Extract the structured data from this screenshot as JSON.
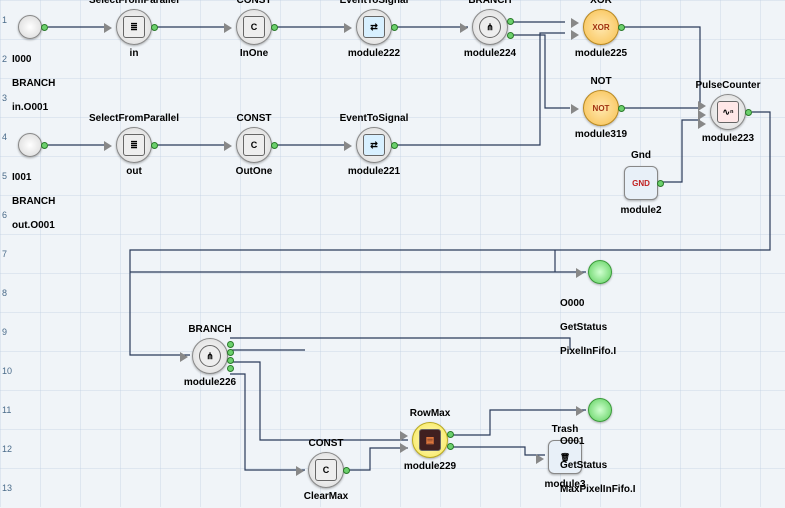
{
  "rowNumbers": [
    "1",
    "2",
    "3",
    "4",
    "5",
    "6",
    "7",
    "8",
    "9",
    "10",
    "11",
    "12",
    "13"
  ],
  "inputs": {
    "I000": {
      "id": "I000",
      "line1": "BRANCH",
      "line2": "in.O001"
    },
    "I001": {
      "id": "I001",
      "line1": "BRANCH",
      "line2": "out.O001"
    }
  },
  "outputs": {
    "O000": {
      "id": "O000",
      "line1": "GetStatus",
      "line2": "PixelInFifo.I"
    },
    "O001": {
      "id": "O001",
      "line1": "GetStatus",
      "line2": "MaxPixelInFifo.I"
    }
  },
  "modules": {
    "sfp_in": {
      "type": "SelectFromParallel",
      "name": "in"
    },
    "sfp_out": {
      "type": "SelectFromParallel",
      "name": "out"
    },
    "const_in": {
      "type": "CONST",
      "name": "InOne",
      "glyph": "C"
    },
    "const_out": {
      "type": "CONST",
      "name": "OutOne",
      "glyph": "C"
    },
    "const_clr": {
      "type": "CONST",
      "name": "ClearMax",
      "glyph": "C"
    },
    "ets222": {
      "type": "EventToSignal",
      "name": "module222"
    },
    "ets221": {
      "type": "EventToSignal",
      "name": "module221"
    },
    "branch224": {
      "type": "BRANCH",
      "name": "module224"
    },
    "branch226": {
      "type": "BRANCH",
      "name": "module226"
    },
    "xor225": {
      "type": "XOR",
      "name": "module225",
      "glyph": "XOR"
    },
    "not319": {
      "type": "NOT",
      "name": "module319",
      "glyph": "NOT"
    },
    "gnd": {
      "type": "Gnd",
      "name": "module2",
      "glyph": "GND"
    },
    "pulse": {
      "type": "PulseCounter",
      "name": "module223"
    },
    "rowmax": {
      "type": "RowMax",
      "name": "module229"
    },
    "trash": {
      "type": "Trash",
      "name": "module3",
      "glyph": "trash"
    }
  }
}
